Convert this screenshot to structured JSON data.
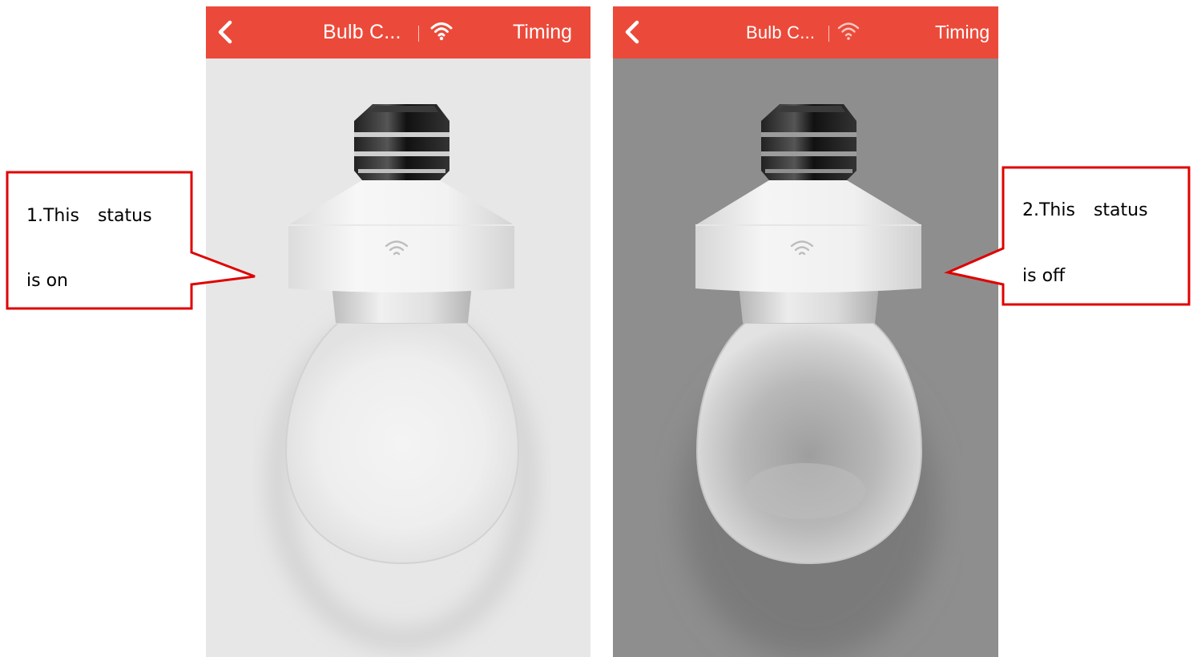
{
  "screens": [
    {
      "state": "on",
      "header": {
        "title": "Bulb C...",
        "right_action": "Timing"
      },
      "back_icon": "chevron-left-icon",
      "wifi_icon": "wifi-icon",
      "background": "#e7e7e7"
    },
    {
      "state": "off",
      "header": {
        "title": "Bulb C...",
        "right_action": "Timing"
      },
      "back_icon": "chevron-left-icon",
      "wifi_icon": "wifi-icon",
      "background": "#8e8e8e"
    }
  ],
  "callouts": [
    {
      "line1": "1.This status",
      "line2": "is on"
    },
    {
      "line1": "2.This status",
      "line2": "is off"
    }
  ],
  "colors": {
    "header_red": "#eb4a3a",
    "callout_border": "#e00000"
  }
}
